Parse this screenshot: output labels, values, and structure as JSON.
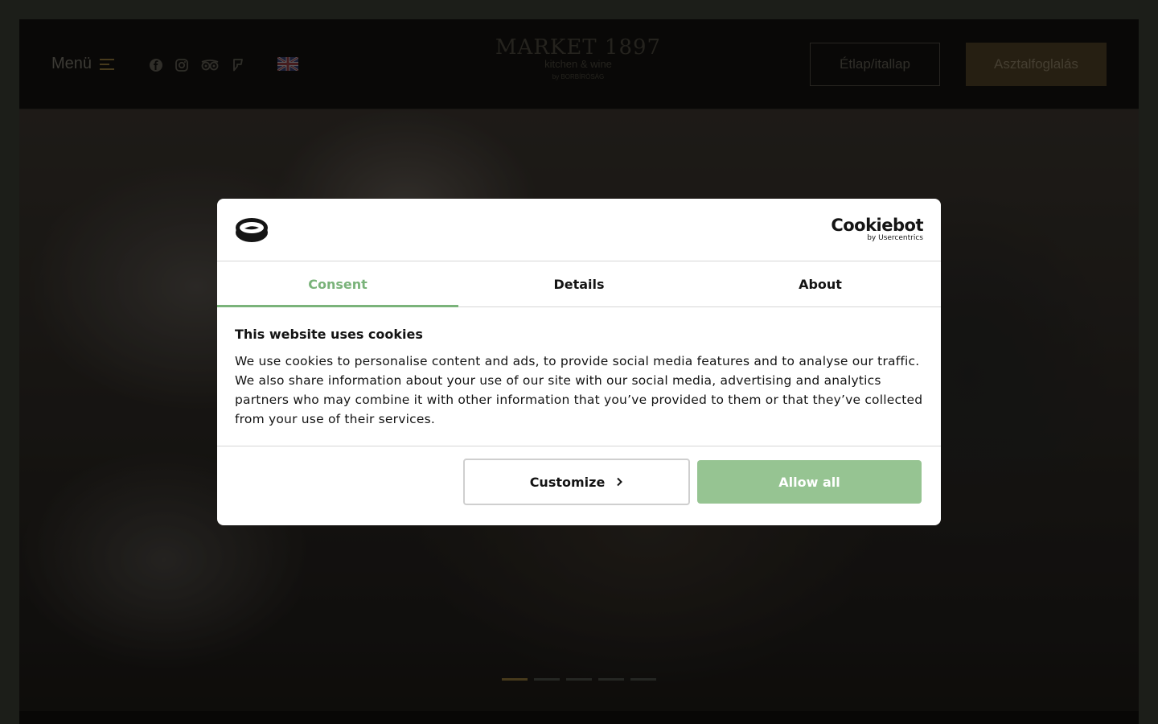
{
  "header": {
    "menu_label": "Menü",
    "logo": {
      "line1": "MARKET 1897",
      "line2": "kitchen & wine",
      "line3": "by BORBÍRÓSÁG"
    },
    "menu_button": "Étlap/itallap",
    "booking_button": "Asztalfoglalás"
  },
  "socials": [
    "facebook-icon",
    "instagram-icon",
    "tripadvisor-icon",
    "foursquare-icon"
  ],
  "language": "uk-flag-icon",
  "slider": {
    "count": 5,
    "active_index": 0
  },
  "colors": {
    "accent": "#7ab37a",
    "allow_button": "#96c492",
    "brand_gold": "#6e5a2c"
  },
  "cookie_dialog": {
    "brand": {
      "name": "Cookiebot",
      "sub": "by Usercentrics"
    },
    "tabs": [
      {
        "label": "Consent",
        "active": true
      },
      {
        "label": "Details",
        "active": false
      },
      {
        "label": "About",
        "active": false
      }
    ],
    "title": "This website uses cookies",
    "text": "We use cookies to personalise content and ads, to provide social media features and to analyse our traffic. We also share information about your use of our site with our social media, advertising and analytics partners who may combine it with other information that you’ve provided to them or that they’ve collected from your use of their services.",
    "customize_label": "Customize",
    "allow_label": "Allow all"
  }
}
